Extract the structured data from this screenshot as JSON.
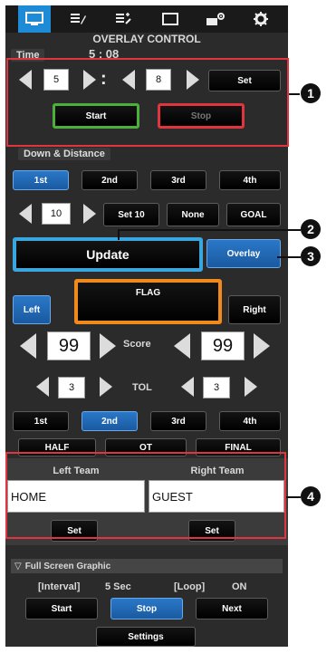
{
  "tabs": [
    {
      "icon": "monitor-icon",
      "active": true
    },
    {
      "icon": "edit-document-icon",
      "active": false
    },
    {
      "icon": "list-edit-icon",
      "active": false
    },
    {
      "icon": "window-icon",
      "active": false
    },
    {
      "icon": "camera-settings-icon",
      "active": false
    },
    {
      "icon": "gear-icon",
      "active": false
    }
  ],
  "title": "OVERLAY CONTROL",
  "time": {
    "label": "Time",
    "display": "5 : 08",
    "minutes": "5",
    "colon": ":",
    "seconds": "8",
    "set": "Set",
    "start": "Start",
    "stop": "Stop"
  },
  "down_distance": {
    "label": "Down & Distance",
    "downs": [
      "1st",
      "2nd",
      "3rd",
      "4th"
    ],
    "distance": "10",
    "set10": "Set 10",
    "none": "None",
    "goal": "GOAL",
    "update": "Update",
    "overlay": "Overlay"
  },
  "flag": {
    "left": "Left",
    "flag": "FLAG",
    "right": "Right"
  },
  "score": {
    "left": "99",
    "label": "Score",
    "right": "99"
  },
  "tol": {
    "left": "3",
    "label": "TOL",
    "right": "3"
  },
  "quarters": [
    "1st",
    "2nd",
    "3rd",
    "4th"
  ],
  "periods": [
    "HALF",
    "OT",
    "FINAL"
  ],
  "teams": {
    "left_label": "Left Team",
    "right_label": "Right Team",
    "left_value": "HOME",
    "right_value": "GUEST",
    "set": "Set"
  },
  "fullscreen": {
    "label": "Full Screen Graphic",
    "interval_label": "[Interval]",
    "interval_value": "5 Sec",
    "loop_label": "[Loop]",
    "loop_value": "ON",
    "start": "Start",
    "stop": "Stop",
    "next": "Next",
    "settings": "Settings"
  },
  "callouts": [
    "1",
    "2",
    "3",
    "4"
  ],
  "colors": {
    "panel": "#2b2b2b",
    "accent_blue": "#1d8bd6",
    "highlight_red": "#e0343f",
    "start_green": "#4caf3c",
    "stop_red": "#e0343f",
    "update_border": "#3aa6e0",
    "flag_border": "#f08a1c"
  }
}
